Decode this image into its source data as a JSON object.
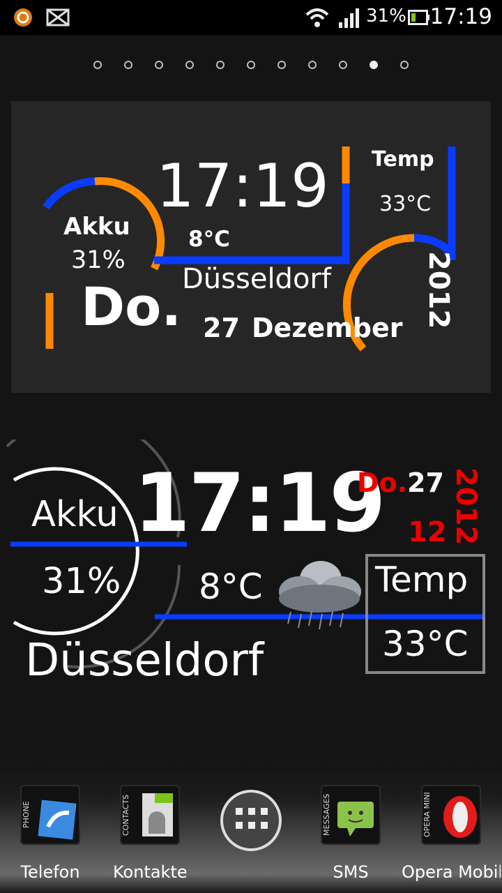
{
  "status_bar": {
    "battery_percent": "31%",
    "battery_level": 0.31,
    "time": "17:19",
    "icons": [
      "avast-icon",
      "mail-notification-icon",
      "wifi-icon",
      "signal-icon",
      "battery-icon"
    ]
  },
  "pager": {
    "count": 11,
    "active_index": 9
  },
  "widget1": {
    "time": "17:19",
    "battery_label": "Akku",
    "battery_value": "31%",
    "current_temp": "8°C",
    "city": "Düsseldorf",
    "weekday": "Do.",
    "day": "27",
    "month": "Dezember",
    "temp_label": "Temp",
    "temp_value": "33°C",
    "year": "2012",
    "colors": {
      "orange": "#ff8a00",
      "blue": "#0a3cff"
    }
  },
  "widget2": {
    "battery_label": "Akku",
    "battery_value": "31%",
    "time": "17:19",
    "weekday": "Do.",
    "day": "27",
    "month_num": "12",
    "year": "2012",
    "current_temp": "8°C",
    "temp_label": "Temp",
    "temp_value": "33°C",
    "city": "Düsseldorf",
    "weather_icon": "rain-cloud-icon",
    "colors": {
      "red": "#ee0000",
      "blue": "#0a3cff"
    }
  },
  "dock": {
    "apps": [
      {
        "label": "Telefon",
        "icon_tag": "PHONE"
      },
      {
        "label": "Kontakte",
        "icon_tag": "CONTACTS"
      },
      {
        "label": "",
        "icon_tag": ""
      },
      {
        "label": "SMS",
        "icon_tag": "MESSAGES"
      },
      {
        "label": "Opera Mobile",
        "icon_tag": "OPERA MINI"
      }
    ]
  }
}
